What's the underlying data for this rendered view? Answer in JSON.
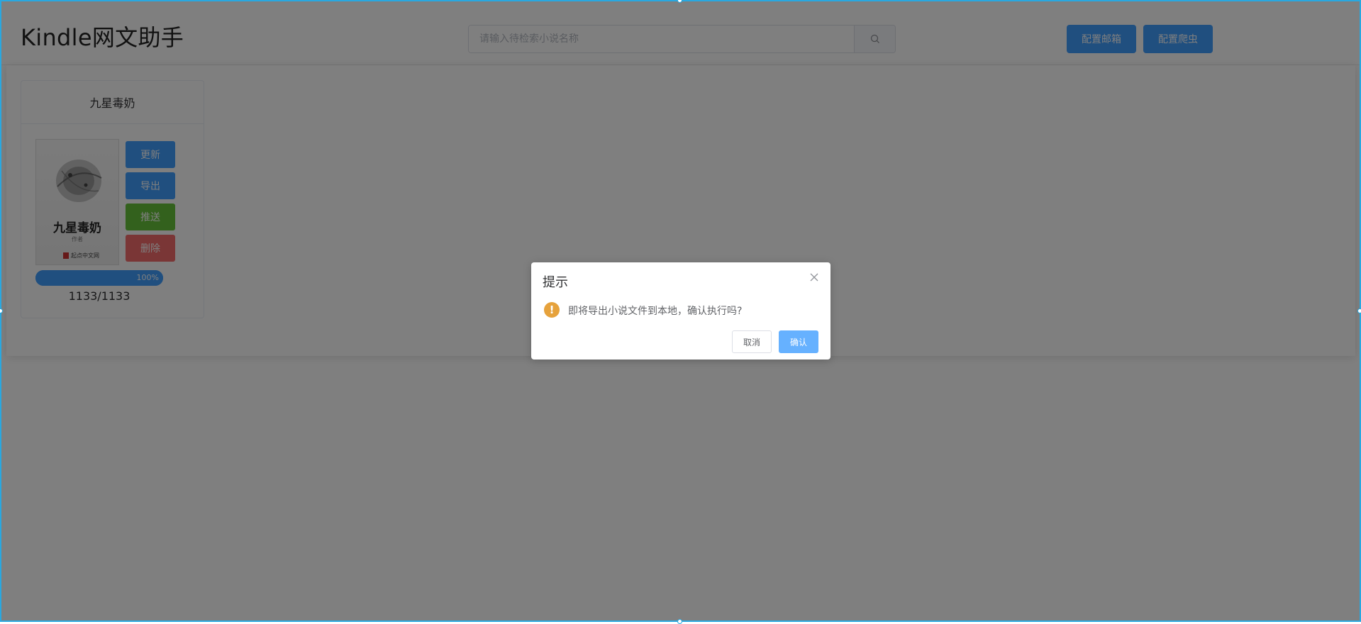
{
  "header": {
    "title": "Kindle网文助手",
    "search_placeholder": "请输入待检索小说名称",
    "config_email_label": "配置邮箱",
    "config_crawler_label": "配置爬虫"
  },
  "book": {
    "name": "九星毒奶",
    "cover_title": "九星毒奶",
    "cover_subtitle": "作者",
    "cover_publisher": "起点中文网",
    "actions": {
      "update": "更新",
      "export": "导出",
      "push": "推送",
      "delete": "删除"
    },
    "progress_fraction": 1.0,
    "progress_label": "100%",
    "chapters": "1133/1133"
  },
  "dialog": {
    "title": "提示",
    "message": "即将导出小说文件到本地，确认执行吗?",
    "cancel_label": "取消",
    "confirm_label": "确认"
  },
  "colors": {
    "primary": "#409eff",
    "success": "#67c23a",
    "danger": "#f56c6c",
    "warning": "#e6a23c",
    "selection_border": "#29a8e0"
  }
}
